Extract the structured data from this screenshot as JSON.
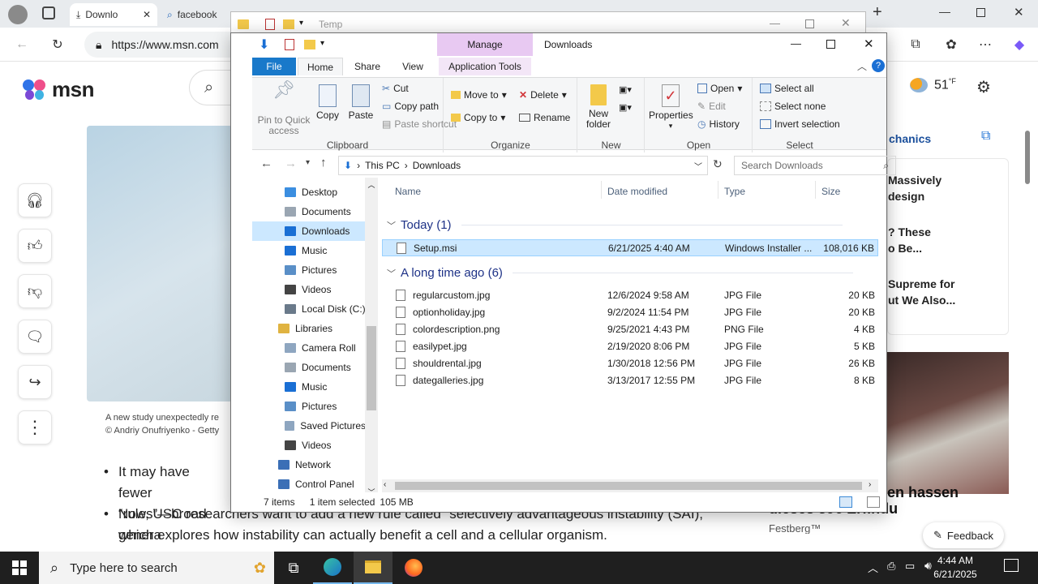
{
  "edge": {
    "tabs": [
      {
        "label": "Downlo",
        "icon": "download-icon"
      },
      {
        "label": "facebook",
        "icon": "search-icon"
      }
    ],
    "url": "https://www.msn.com"
  },
  "msn": {
    "logo": "msn",
    "weather": "51",
    "weather_unit": "°F",
    "caption_line1": "A new study unexpectedly re",
    "caption_line2": "© Andriy Onufriyenko - Getty",
    "bullets": [
      {
        "line1": "It may have fewer",
        "line2": "“rules”—broad genera"
      },
      {
        "line1": "Now, USC researchers want to add a new rule called “selectively advantageous instability (SAI),",
        "line2": "which explores how instability can actually benefit a cell and a cellular organism."
      }
    ],
    "right_header": "chanics",
    "right_items": [
      {
        "line1": "Massively",
        "line2": "design"
      },
      {
        "line1": "? These",
        "line2": "o Be..."
      },
      {
        "line1": "Supreme for",
        "line2": "ut We Also..."
      }
    ],
    "ad_text": "dieses 39€ Erfindu",
    "ad_text2": "en hassen",
    "ad_source": "Festberg™",
    "feedback": "Feedback"
  },
  "explorer": {
    "title": "Temp",
    "window_title": "Downloads",
    "ribbon_tabs": {
      "file": "File",
      "home": "Home",
      "share": "Share",
      "view": "View",
      "manage": "Manage",
      "app_tools": "Application Tools"
    },
    "clipboard": {
      "pin": "Pin to Quick access",
      "copy": "Copy",
      "paste": "Paste",
      "cut": "Cut",
      "copy_path": "Copy path",
      "paste_shortcut": "Paste shortcut",
      "label": "Clipboard"
    },
    "organize": {
      "move_to": "Move to",
      "copy_to": "Copy to",
      "delete": "Delete",
      "rename": "Rename",
      "label": "Organize"
    },
    "new": {
      "new_folder": "New folder",
      "label": "New"
    },
    "open": {
      "properties": "Properties",
      "open": "Open",
      "edit": "Edit",
      "history": "History",
      "label": "Open"
    },
    "select": {
      "select_all": "Select all",
      "select_none": "Select none",
      "invert": "Invert selection",
      "label": "Select"
    },
    "path": {
      "this_pc": "This PC",
      "downloads": "Downloads"
    },
    "search_placeholder": "Search Downloads",
    "nav": [
      {
        "label": "Desktop",
        "icon": "desktop-icon",
        "indent": 1
      },
      {
        "label": "Documents",
        "icon": "documents-icon",
        "indent": 1
      },
      {
        "label": "Downloads",
        "icon": "downloads-icon",
        "indent": 1,
        "selected": true
      },
      {
        "label": "Music",
        "icon": "music-icon",
        "indent": 1
      },
      {
        "label": "Pictures",
        "icon": "pictures-icon",
        "indent": 1
      },
      {
        "label": "Videos",
        "icon": "videos-icon",
        "indent": 1
      },
      {
        "label": "Local Disk (C:)",
        "icon": "drive-icon",
        "indent": 1
      },
      {
        "label": "Libraries",
        "icon": "libraries-icon",
        "indent": 0
      },
      {
        "label": "Camera Roll",
        "icon": "folder-icon",
        "indent": 1
      },
      {
        "label": "Documents",
        "icon": "documents-icon",
        "indent": 1
      },
      {
        "label": "Music",
        "icon": "music-icon",
        "indent": 1
      },
      {
        "label": "Pictures",
        "icon": "pictures-icon",
        "indent": 1
      },
      {
        "label": "Saved Pictures",
        "icon": "folder-icon",
        "indent": 1
      },
      {
        "label": "Videos",
        "icon": "videos-icon",
        "indent": 1
      },
      {
        "label": "Network",
        "icon": "network-icon",
        "indent": 0
      },
      {
        "label": "Control Panel",
        "icon": "control-panel-icon",
        "indent": 0
      }
    ],
    "columns": {
      "name": "Name",
      "date": "Date modified",
      "type": "Type",
      "size": "Size"
    },
    "groups": [
      {
        "header": "Today (1)",
        "files": [
          {
            "name": "Setup.msi",
            "date": "6/21/2025 4:40 AM",
            "type": "Windows Installer ...",
            "size": "108,016 KB",
            "selected": true
          }
        ]
      },
      {
        "header": "A long time ago (6)",
        "files": [
          {
            "name": "regularcustom.jpg",
            "date": "12/6/2024 9:58 AM",
            "type": "JPG File",
            "size": "20 KB"
          },
          {
            "name": "optionholiday.jpg",
            "date": "9/2/2024 11:54 PM",
            "type": "JPG File",
            "size": "20 KB"
          },
          {
            "name": "colordescription.png",
            "date": "9/25/2021 4:43 PM",
            "type": "PNG File",
            "size": "4 KB"
          },
          {
            "name": "easilypet.jpg",
            "date": "2/19/2020 8:06 PM",
            "type": "JPG File",
            "size": "5 KB"
          },
          {
            "name": "shouldrental.jpg",
            "date": "1/30/2018 12:56 PM",
            "type": "JPG File",
            "size": "26 KB"
          },
          {
            "name": "dategalleries.jpg",
            "date": "3/13/2017 12:55 PM",
            "type": "JPG File",
            "size": "8 KB"
          }
        ]
      }
    ],
    "status": {
      "items": "7 items",
      "selected": "1 item selected",
      "size": "105 MB"
    }
  },
  "taskbar": {
    "search_placeholder": "Type here to search",
    "time": "4:44 AM",
    "date": "6/21/2025"
  },
  "colors": {
    "accent": "#0078d7",
    "selection": "#cce8ff",
    "taskbar": "#1f1f1f",
    "manage_tab": "#e8c9f2"
  }
}
